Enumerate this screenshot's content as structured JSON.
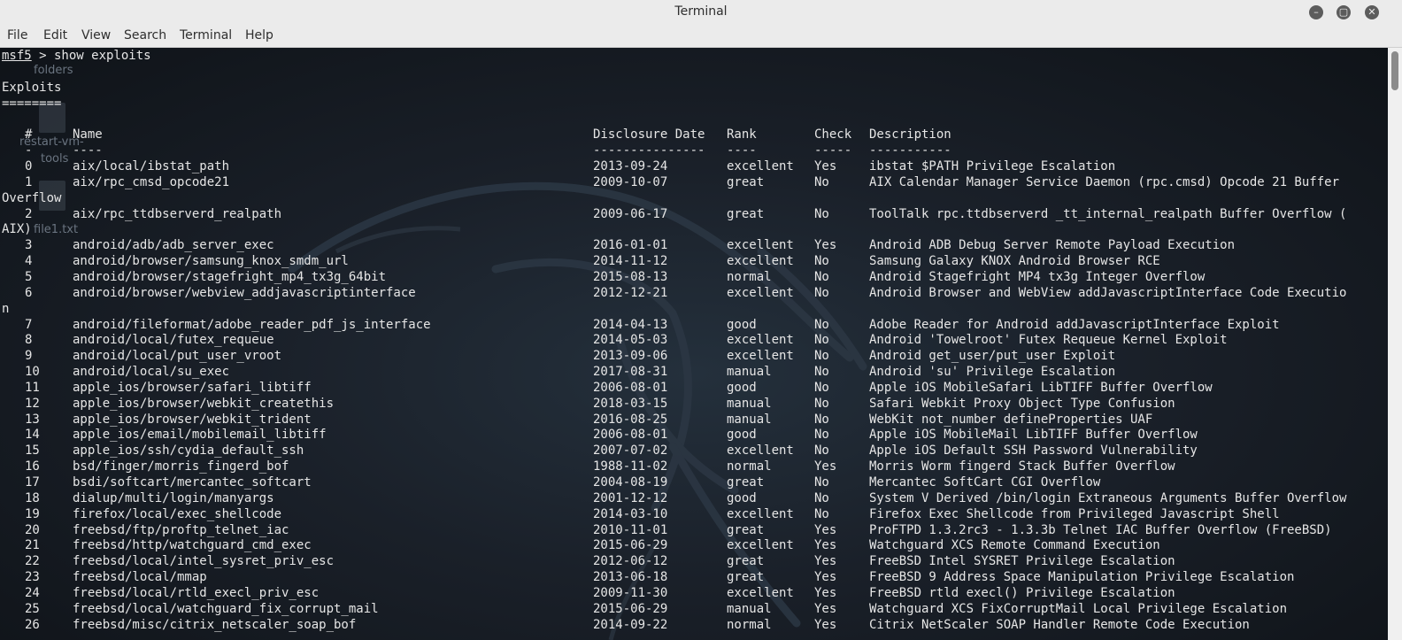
{
  "window": {
    "title": "Terminal",
    "controls": [
      "–",
      "▢",
      "✕"
    ]
  },
  "menu": [
    "File",
    "Edit",
    "View",
    "Search",
    "Terminal",
    "Help"
  ],
  "desktop": {
    "labels": [
      "folders",
      "restart-vm-",
      "tools",
      "file1.txt"
    ]
  },
  "terminal": {
    "prompt": "msf5",
    "command": " > show exploits",
    "section_title": "Exploits",
    "section_rule": "========",
    "headers": [
      "#",
      "Name",
      "Disclosure Date",
      "Rank",
      "Check",
      "Description"
    ],
    "header_rules": [
      "-",
      "----",
      "---------------",
      "----",
      "-----",
      "-----------"
    ],
    "rows": [
      {
        "num": "0",
        "name": "aix/local/ibstat_path",
        "date": "2013-09-24",
        "rank": "excellent",
        "check": "Yes",
        "desc": "ibstat $PATH Privilege Escalation"
      },
      {
        "num": "1",
        "name": "aix/rpc_cmsd_opcode21",
        "date": "2009-10-07",
        "rank": "great",
        "check": "No",
        "desc": "AIX Calendar Manager Service Daemon (rpc.cmsd) Opcode 21 Buffer"
      },
      {
        "wrap": "Overflow"
      },
      {
        "num": "2",
        "name": "aix/rpc_ttdbserverd_realpath",
        "date": "2009-06-17",
        "rank": "great",
        "check": "No",
        "desc": "ToolTalk rpc.ttdbserverd _tt_internal_realpath Buffer Overflow ("
      },
      {
        "wrap": "AIX)"
      },
      {
        "num": "3",
        "name": "android/adb/adb_server_exec",
        "date": "2016-01-01",
        "rank": "excellent",
        "check": "Yes",
        "desc": "Android ADB Debug Server Remote Payload Execution"
      },
      {
        "num": "4",
        "name": "android/browser/samsung_knox_smdm_url",
        "date": "2014-11-12",
        "rank": "excellent",
        "check": "No",
        "desc": "Samsung Galaxy KNOX Android Browser RCE"
      },
      {
        "num": "5",
        "name": "android/browser/stagefright_mp4_tx3g_64bit",
        "date": "2015-08-13",
        "rank": "normal",
        "check": "No",
        "desc": "Android Stagefright MP4 tx3g Integer Overflow"
      },
      {
        "num": "6",
        "name": "android/browser/webview_addjavascriptinterface",
        "date": "2012-12-21",
        "rank": "excellent",
        "check": "No",
        "desc": "Android Browser and WebView addJavascriptInterface Code Executio"
      },
      {
        "wrap": "n"
      },
      {
        "num": "7",
        "name": "android/fileformat/adobe_reader_pdf_js_interface",
        "date": "2014-04-13",
        "rank": "good",
        "check": "No",
        "desc": "Adobe Reader for Android addJavascriptInterface Exploit"
      },
      {
        "num": "8",
        "name": "android/local/futex_requeue",
        "date": "2014-05-03",
        "rank": "excellent",
        "check": "No",
        "desc": "Android 'Towelroot' Futex Requeue Kernel Exploit"
      },
      {
        "num": "9",
        "name": "android/local/put_user_vroot",
        "date": "2013-09-06",
        "rank": "excellent",
        "check": "No",
        "desc": "Android get_user/put_user Exploit"
      },
      {
        "num": "10",
        "name": "android/local/su_exec",
        "date": "2017-08-31",
        "rank": "manual",
        "check": "No",
        "desc": "Android 'su' Privilege Escalation"
      },
      {
        "num": "11",
        "name": "apple_ios/browser/safari_libtiff",
        "date": "2006-08-01",
        "rank": "good",
        "check": "No",
        "desc": "Apple iOS MobileSafari LibTIFF Buffer Overflow"
      },
      {
        "num": "12",
        "name": "apple_ios/browser/webkit_createthis",
        "date": "2018-03-15",
        "rank": "manual",
        "check": "No",
        "desc": "Safari Webkit Proxy Object Type Confusion"
      },
      {
        "num": "13",
        "name": "apple_ios/browser/webkit_trident",
        "date": "2016-08-25",
        "rank": "manual",
        "check": "No",
        "desc": "WebKit not_number defineProperties UAF"
      },
      {
        "num": "14",
        "name": "apple_ios/email/mobilemail_libtiff",
        "date": "2006-08-01",
        "rank": "good",
        "check": "No",
        "desc": "Apple iOS MobileMail LibTIFF Buffer Overflow"
      },
      {
        "num": "15",
        "name": "apple_ios/ssh/cydia_default_ssh",
        "date": "2007-07-02",
        "rank": "excellent",
        "check": "No",
        "desc": "Apple iOS Default SSH Password Vulnerability"
      },
      {
        "num": "16",
        "name": "bsd/finger/morris_fingerd_bof",
        "date": "1988-11-02",
        "rank": "normal",
        "check": "Yes",
        "desc": "Morris Worm fingerd Stack Buffer Overflow"
      },
      {
        "num": "17",
        "name": "bsdi/softcart/mercantec_softcart",
        "date": "2004-08-19",
        "rank": "great",
        "check": "No",
        "desc": "Mercantec SoftCart CGI Overflow"
      },
      {
        "num": "18",
        "name": "dialup/multi/login/manyargs",
        "date": "2001-12-12",
        "rank": "good",
        "check": "No",
        "desc": "System V Derived /bin/login Extraneous Arguments Buffer Overflow"
      },
      {
        "num": "19",
        "name": "firefox/local/exec_shellcode",
        "date": "2014-03-10",
        "rank": "excellent",
        "check": "No",
        "desc": "Firefox Exec Shellcode from Privileged Javascript Shell"
      },
      {
        "num": "20",
        "name": "freebsd/ftp/proftp_telnet_iac",
        "date": "2010-11-01",
        "rank": "great",
        "check": "Yes",
        "desc": "ProFTPD 1.3.2rc3 - 1.3.3b Telnet IAC Buffer Overflow (FreeBSD)"
      },
      {
        "num": "21",
        "name": "freebsd/http/watchguard_cmd_exec",
        "date": "2015-06-29",
        "rank": "excellent",
        "check": "Yes",
        "desc": "Watchguard XCS Remote Command Execution"
      },
      {
        "num": "22",
        "name": "freebsd/local/intel_sysret_priv_esc",
        "date": "2012-06-12",
        "rank": "great",
        "check": "Yes",
        "desc": "FreeBSD Intel SYSRET Privilege Escalation"
      },
      {
        "num": "23",
        "name": "freebsd/local/mmap",
        "date": "2013-06-18",
        "rank": "great",
        "check": "Yes",
        "desc": "FreeBSD 9 Address Space Manipulation Privilege Escalation"
      },
      {
        "num": "24",
        "name": "freebsd/local/rtld_execl_priv_esc",
        "date": "2009-11-30",
        "rank": "excellent",
        "check": "Yes",
        "desc": "FreeBSD rtld execl() Privilege Escalation"
      },
      {
        "num": "25",
        "name": "freebsd/local/watchguard_fix_corrupt_mail",
        "date": "2015-06-29",
        "rank": "manual",
        "check": "Yes",
        "desc": "Watchguard XCS FixCorruptMail Local Privilege Escalation"
      },
      {
        "num": "26",
        "name": "freebsd/misc/citrix_netscaler_soap_bof",
        "date": "2014-09-22",
        "rank": "normal",
        "check": "Yes",
        "desc": "Citrix NetScaler SOAP Handler Remote Code Execution"
      }
    ]
  }
}
